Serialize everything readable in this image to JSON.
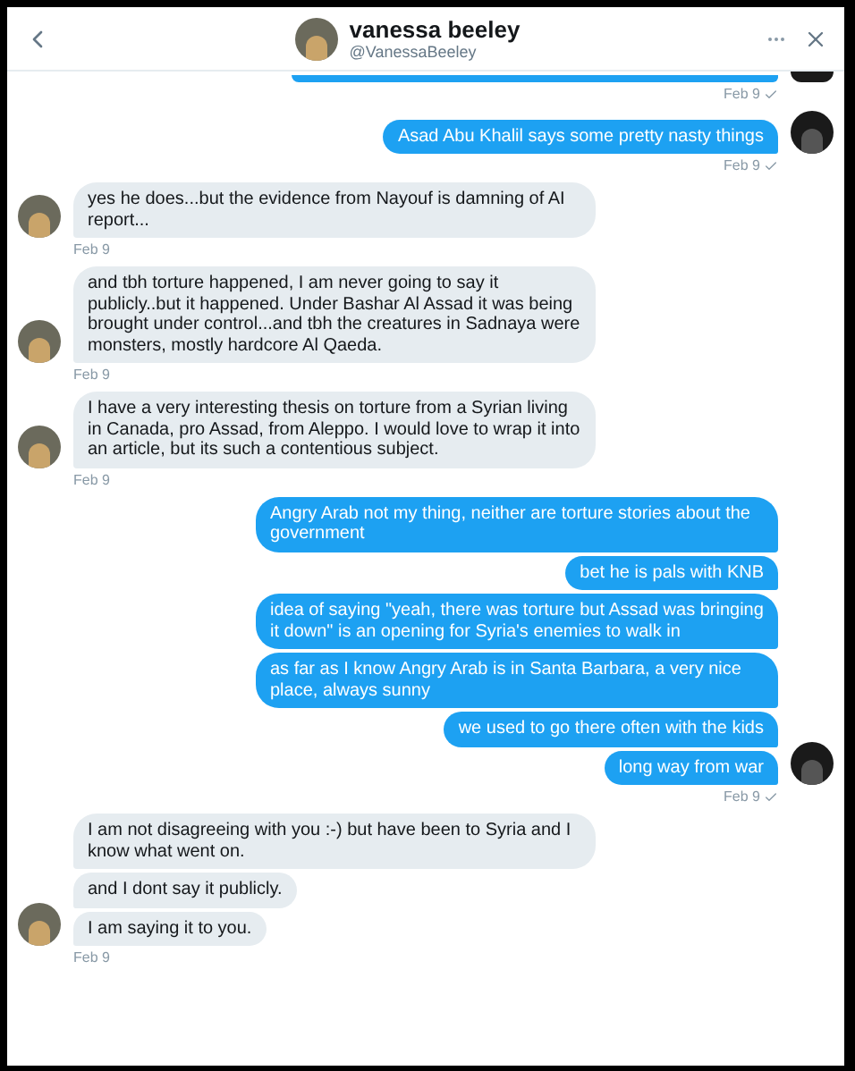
{
  "header": {
    "name": "vanessa beeley",
    "handle": "@VanessaBeeley"
  },
  "groups": [
    {
      "kind": "sent",
      "clipped": true,
      "time": "Feb 9",
      "check": true
    },
    {
      "kind": "sent",
      "messages": [
        "Asad Abu Khalil says some pretty nasty things"
      ],
      "time": "Feb 9",
      "check": true
    },
    {
      "kind": "received",
      "messages": [
        "yes he does...but the evidence from Nayouf is damning of AI report..."
      ],
      "time": "Feb 9",
      "check": false
    },
    {
      "kind": "received",
      "messages": [
        "and tbh torture happened, I am never going to say it publicly..but it happened. Under Bashar Al Assad it was being brought under control...and tbh the creatures in Sadnaya were monsters, mostly hardcore Al Qaeda."
      ],
      "time": "Feb 9",
      "check": false
    },
    {
      "kind": "received",
      "messages": [
        "I have a  very interesting thesis on torture from a Syrian living in Canada, pro Assad, from Aleppo.  I would love to wrap it into an article, but its such a contentious subject."
      ],
      "time": "Feb 9",
      "check": false
    },
    {
      "kind": "sent",
      "messages": [
        "Angry Arab not my thing, neither are torture stories about the government",
        "bet he is pals with KNB",
        "idea of saying \"yeah, there was torture but Assad was bringing it down\" is an opening for Syria's enemies to walk in",
        "as far as I know Angry Arab is in Santa Barbara, a very nice place, always sunny",
        "we used to go there often with the kids",
        "long way from war"
      ],
      "time": "Feb 9",
      "check": true
    },
    {
      "kind": "received",
      "messages": [
        "I am not disagreeing with you :-) but have been to Syria and I know what went on.",
        "and I dont say it publicly.",
        "I am saying it to you."
      ],
      "time": "Feb 9",
      "check": false
    }
  ]
}
